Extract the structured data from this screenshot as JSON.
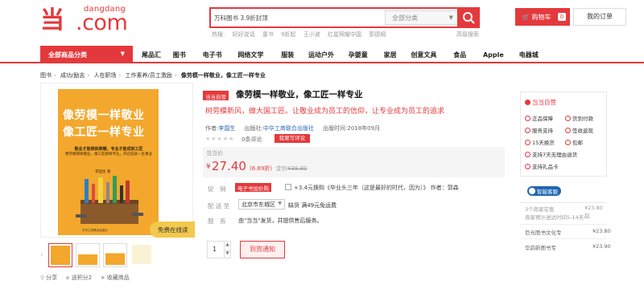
{
  "brand": {
    "small": "dangdang",
    "large": ".com",
    "color": "#e4393c"
  },
  "search": {
    "value": "万科图书 3.9折封顶",
    "category": "全部分类",
    "hot_label": "热搜:",
    "hot_terms": [
      "好好说话",
      "童书",
      "9折起",
      "王小波",
      "红星照耀中国",
      "郭德纲"
    ],
    "advanced": "高级搜索"
  },
  "header": {
    "cart_label": "购物车",
    "cart_count": "0",
    "orders_label": "我的订单"
  },
  "nav": {
    "all_categories": "全部商品分类",
    "items": [
      "尾品汇",
      "图书",
      "电子书",
      "网络文学",
      "服装",
      "运动户外",
      "孕婴童",
      "家居",
      "创意文具",
      "食品",
      "Apple",
      "电器城"
    ]
  },
  "breadcrumb": [
    "图书",
    "成功/励志",
    "人在职场",
    "工作素养/员工激励",
    "像劳模一样敬业，像工匠一样专业"
  ],
  "cover": {
    "title_line1": "像劳模一样敬业",
    "title_line2": "像工匠一样专业",
    "subtitle": "敬业才能铸就荣耀，专业才能成就工匠",
    "blurb": "像劳模那样敬业，做工匠那样专业，开启成就一生事业",
    "author": "李国生 著",
    "publisher": "中华工商联合出版社"
  },
  "free_read": "免费在线读",
  "share": [
    "分享",
    "送积分2",
    "收藏商品"
  ],
  "product": {
    "badge": "当当自营",
    "title": "像劳模一样敬业，像工匠一样专业",
    "subtitle": "树劳模新风，做大国工匠。让敬业成为员工的信仰，让专业成为员工的追求",
    "author_label": "作者:",
    "author": "李国生",
    "publisher_label": "出版社:",
    "publisher": "中华工商联合出版社",
    "date_label": "出版时间:",
    "date": "2018年09月",
    "stars": "★★★★★",
    "review_count": "0条评论",
    "write_review": "我要写评论",
    "price_label": "当当价",
    "currency": "¥",
    "price": "27.40",
    "discount": "(6.89折)",
    "orig_label": "定价",
    "orig_price": "¥39.80",
    "promo_label": "促　销",
    "promo_tag": "电子书加价购",
    "promo_text": "+3.4元换购《毕业头三年（这是最好的时代，因为）》 作者：郭森",
    "ship_label": "配 送 至",
    "ship_value": "北京市东城区",
    "ship_stock": "缺货  满49元免运费",
    "service_label": "服　务",
    "service_text": "由\"当当\"发货，并提供售后服务。",
    "qty": "1",
    "notify": "到货通知"
  },
  "sidebar": {
    "title": "当当自营",
    "items": [
      "正品保障",
      "货到付款",
      "服务支持",
      "签收返现",
      "15天换货",
      "包邮",
      "支持7天无理由退货",
      "支持礼品卡"
    ],
    "cs_label": "智能客服"
  },
  "sellers": {
    "head": "3个商家在售",
    "head_price": "¥23.80起",
    "sub": "商家预计送达时间5-14天",
    "rows": [
      {
        "name": "巨光图书文化专",
        "price": "¥23.80"
      },
      {
        "name": "华韵新图书专",
        "price": "¥23.90"
      }
    ]
  }
}
